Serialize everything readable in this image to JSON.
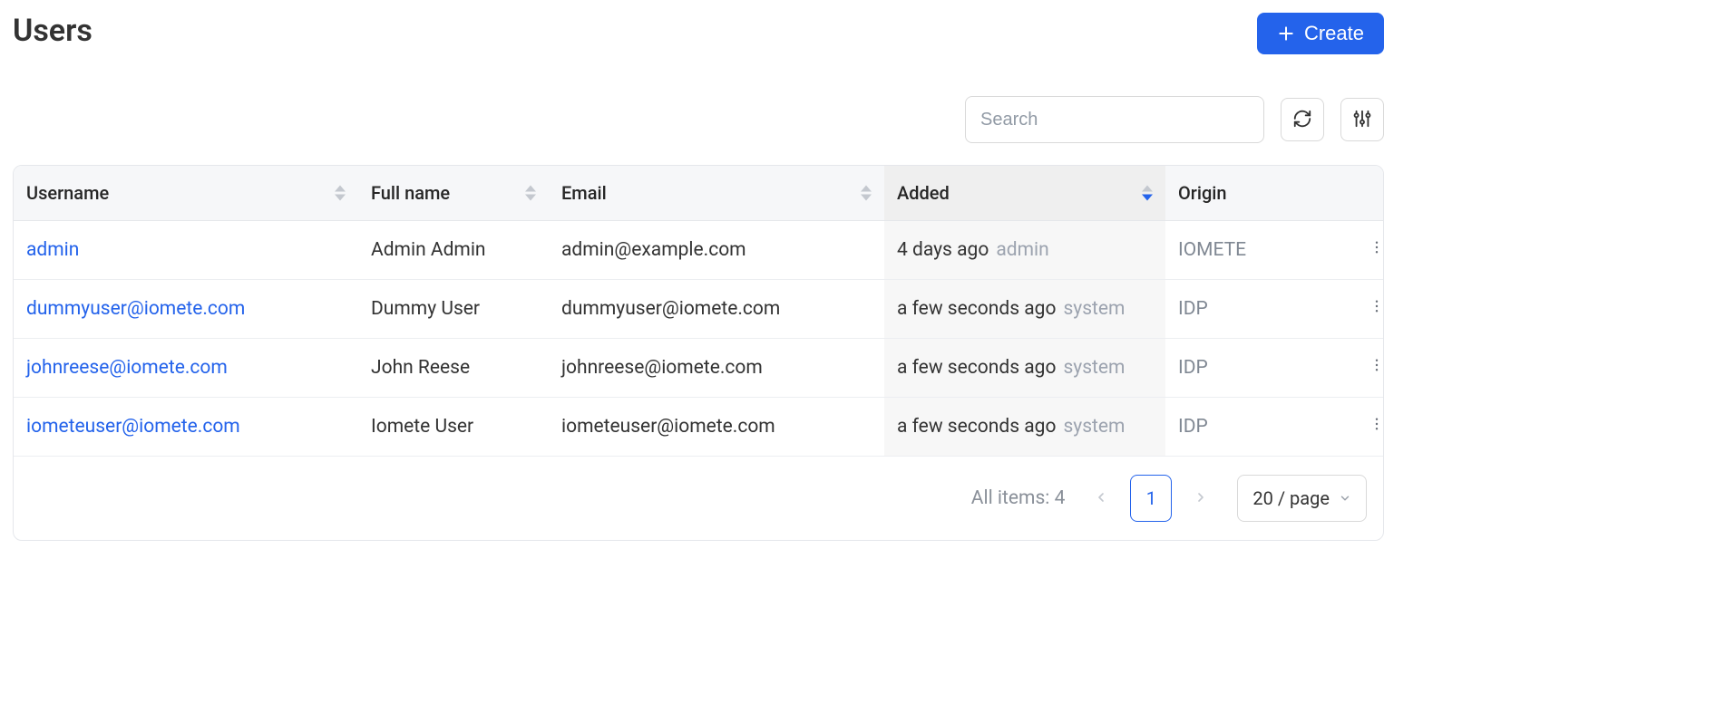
{
  "header": {
    "title": "Users",
    "create_label": "Create"
  },
  "toolbar": {
    "search_placeholder": "Search"
  },
  "table": {
    "columns": {
      "username": "Username",
      "fullname": "Full name",
      "email": "Email",
      "added": "Added",
      "origin": "Origin"
    },
    "rows": [
      {
        "username": "admin",
        "fullname": "Admin Admin",
        "email": "admin@example.com",
        "added_time": "4 days ago",
        "added_by": "admin",
        "origin": "IOMETE"
      },
      {
        "username": "dummyuser@iomete.com",
        "fullname": "Dummy User",
        "email": "dummyuser@iomete.com",
        "added_time": "a few seconds ago",
        "added_by": "system",
        "origin": "IDP"
      },
      {
        "username": "johnreese@iomete.com",
        "fullname": "John Reese",
        "email": "johnreese@iomete.com",
        "added_time": "a few seconds ago",
        "added_by": "system",
        "origin": "IDP"
      },
      {
        "username": "iometeuser@iomete.com",
        "fullname": "Iomete User",
        "email": "iometeuser@iomete.com",
        "added_time": "a few seconds ago",
        "added_by": "system",
        "origin": "IDP"
      }
    ]
  },
  "footer": {
    "count_label": "All items: 4",
    "current_page": "1",
    "page_size_label": "20 / page"
  }
}
